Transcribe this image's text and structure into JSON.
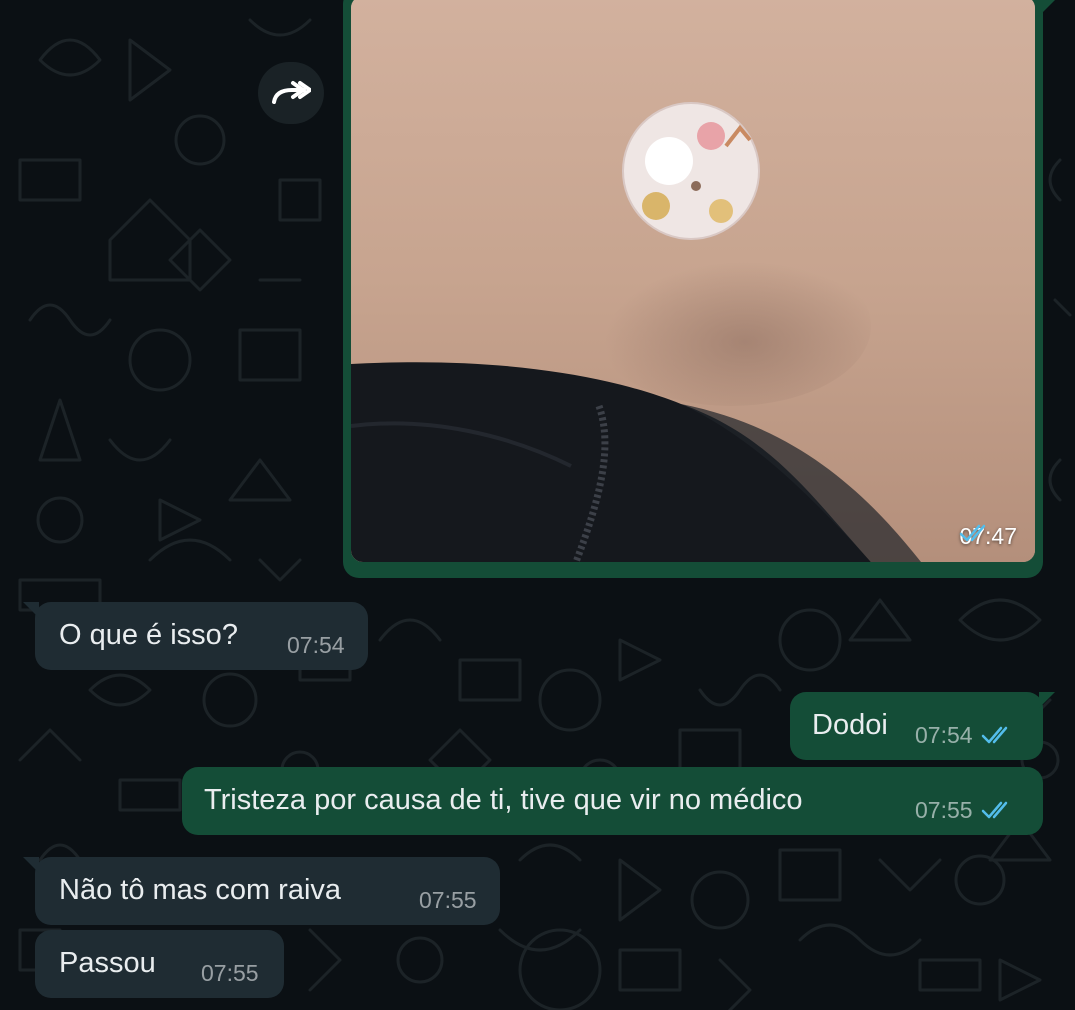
{
  "image_message": {
    "time": "07:47",
    "status": "read",
    "tick_color": "#53bdeb",
    "forward_icon": "forward-icon"
  },
  "messages": [
    {
      "direction": "incoming",
      "text": "O que é isso?",
      "time": "07:54"
    },
    {
      "direction": "outgoing",
      "text": "Dodoi",
      "time": "07:54",
      "status": "read"
    },
    {
      "direction": "outgoing",
      "text": "Tristeza por causa de ti, tive que vir no médico",
      "time": "07:55",
      "status": "read"
    },
    {
      "direction": "incoming",
      "text": "Não tô mas com raiva",
      "time": "07:55"
    },
    {
      "direction": "incoming",
      "text": "Passou",
      "time": "07:55"
    }
  ],
  "colors": {
    "background": "#0b1014",
    "incoming_bubble": "#1f2c33",
    "outgoing_bubble": "#144d37",
    "read_ticks": "#53bdeb"
  }
}
